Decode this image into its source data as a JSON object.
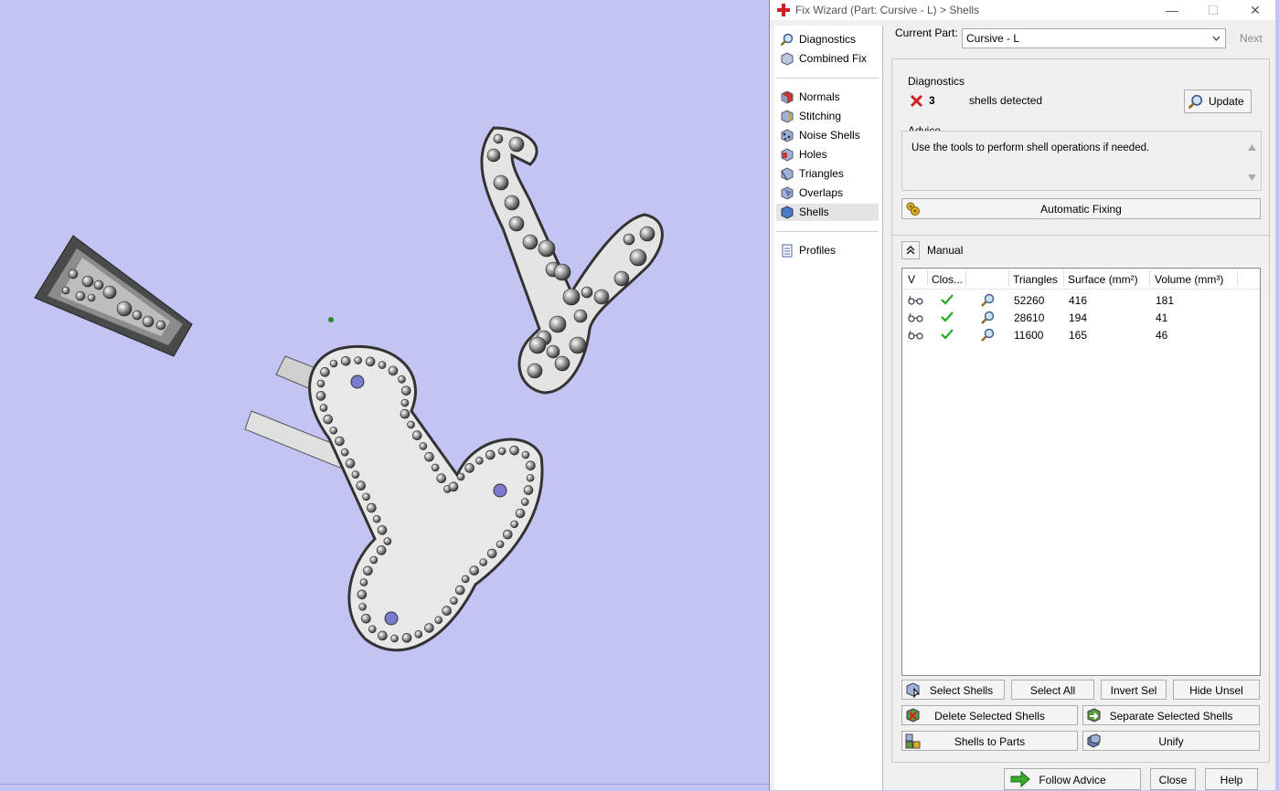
{
  "window": {
    "title": "Fix Wizard (Part: Cursive - L) > Shells",
    "minimize": "—",
    "maximize": "☐",
    "close": "✕"
  },
  "nav": {
    "group1": [
      {
        "label": "Diagnostics",
        "icon": "magnifier-icon"
      },
      {
        "label": "Combined Fix",
        "icon": "cube-icon"
      }
    ],
    "group2": [
      {
        "label": "Normals",
        "icon": "normals-cube-icon"
      },
      {
        "label": "Stitching",
        "icon": "stitching-cube-icon"
      },
      {
        "label": "Noise Shells",
        "icon": "noise-shells-icon"
      },
      {
        "label": "Holes",
        "icon": "holes-cube-icon"
      },
      {
        "label": "Triangles",
        "icon": "triangles-cube-icon"
      },
      {
        "label": "Overlaps",
        "icon": "overlaps-cube-icon"
      },
      {
        "label": "Shells",
        "icon": "shells-cube-icon",
        "selected": true
      }
    ],
    "group3": [
      {
        "label": "Profiles",
        "icon": "profiles-document-icon"
      }
    ]
  },
  "current_part": {
    "label": "Current Part:",
    "value": "Cursive - L",
    "next_label": "Next"
  },
  "diagnostics": {
    "title": "Diagnostics",
    "count": "3",
    "status_text": "shells detected",
    "update_label": "Update"
  },
  "advice": {
    "title": "Advice",
    "text": "Use the tools to perform shell operations if needed."
  },
  "automatic_fixing": {
    "label": "Automatic Fixing"
  },
  "manual": {
    "label": "Manual"
  },
  "table": {
    "columns": [
      "V",
      "Clos...",
      "",
      "Triangles",
      "Surface (mm²)",
      "Volume (mm³)"
    ],
    "rows": [
      {
        "triangles": "52260",
        "surface": "416",
        "volume": "181"
      },
      {
        "triangles": "28610",
        "surface": "194",
        "volume": "41"
      },
      {
        "triangles": "11600",
        "surface": "165",
        "volume": "46"
      }
    ]
  },
  "buttons": {
    "select_shells": "Select Shells",
    "select_all": "Select All",
    "invert_sel": "Invert Sel",
    "hide_unsel": "Hide Unsel",
    "delete_selected_shells": "Delete Selected Shells",
    "separate_selected_shells": "Separate Selected Shells",
    "shells_to_parts": "Shells to Parts",
    "unify": "Unify",
    "follow_advice": "Follow Advice",
    "close": "Close",
    "help": "Help"
  },
  "colors": {
    "viewport_bg": "#c4c4f4",
    "error_red": "#cc2222",
    "check_green": "#22aa22"
  }
}
